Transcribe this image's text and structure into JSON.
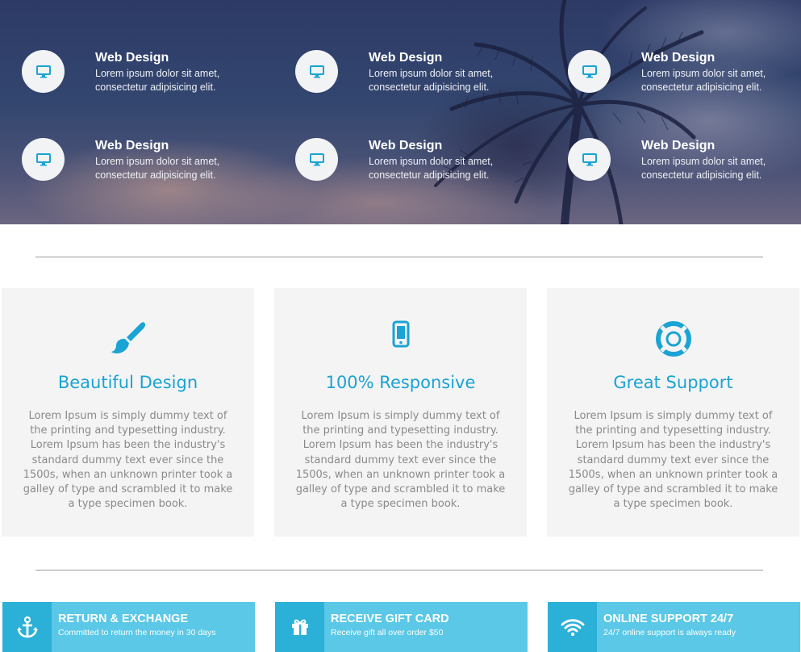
{
  "hero": {
    "features": [
      {
        "icon": "monitor-icon",
        "title": "Web Design",
        "desc": "Lorem ipsum dolor sit amet, consectetur adipisicing elit."
      },
      {
        "icon": "monitor-icon",
        "title": "Web Design",
        "desc": "Lorem ipsum dolor sit amet, consectetur adipisicing elit."
      },
      {
        "icon": "monitor-icon",
        "title": "Web Design",
        "desc": "Lorem ipsum dolor sit amet, consectetur adipisicing elit."
      },
      {
        "icon": "monitor-icon",
        "title": "Web Design",
        "desc": "Lorem ipsum dolor sit amet, consectetur adipisicing elit."
      },
      {
        "icon": "monitor-icon",
        "title": "Web Design",
        "desc": "Lorem ipsum dolor sit amet, consectetur adipisicing elit."
      },
      {
        "icon": "monitor-icon",
        "title": "Web Design",
        "desc": "Lorem ipsum dolor sit amet, consectetur adipisicing elit."
      }
    ]
  },
  "cards": [
    {
      "icon": "paintbrush-icon",
      "title": "Beautiful Design",
      "text": "Lorem Ipsum is simply dummy text of the printing and typesetting industry. Lorem Ipsum has been the industry's standard dummy text ever since the 1500s, when an unknown printer took a galley of type and scrambled it to make a type specimen book."
    },
    {
      "icon": "mobile-phone-icon",
      "title": "100% Responsive",
      "text": "Lorem Ipsum is simply dummy text of the printing and typesetting industry. Lorem Ipsum has been the industry's standard dummy text ever since the 1500s, when an unknown printer took a galley of type and scrambled it to make a type specimen book."
    },
    {
      "icon": "life-ring-icon",
      "title": "Great Support",
      "text": "Lorem Ipsum is simply dummy text of the printing and typesetting industry. Lorem Ipsum has been the industry's standard dummy text ever since the 1500s, when an unknown printer took a galley of type and scrambled it to make a type specimen book."
    }
  ],
  "bars": [
    {
      "icon": "anchor-icon",
      "title": "RETURN & EXCHANGE",
      "sub": "Committed to return the money in 30 days"
    },
    {
      "icon": "gift-icon",
      "title": "RECEIVE GIFT CARD",
      "sub": "Receive gift all over order $50"
    },
    {
      "icon": "wifi-icon",
      "title": "ONLINE SUPPORT 24/7",
      "sub": "24/7 online support is always ready"
    }
  ],
  "colors": {
    "accent": "#1aa3d4",
    "bar_bg": "#5ac8e6",
    "bar_icon_bg": "#2bb0d8",
    "card_bg": "#f4f4f4",
    "hero_circle": "#f2f3f5"
  }
}
